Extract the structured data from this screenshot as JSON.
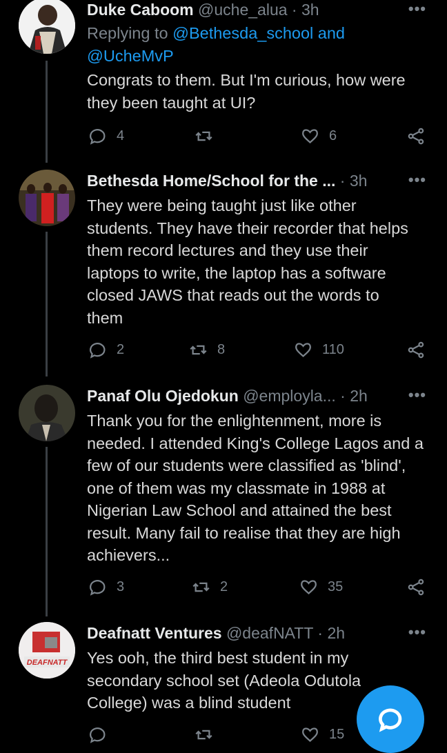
{
  "tweets": [
    {
      "name": "Duke Caboom",
      "handle": "@uche_alua",
      "time": "3h",
      "reply_prefix": "Replying to ",
      "reply_mention1": "@Bethesda_school",
      "reply_and": " and",
      "reply_mention2": "@UcheMvP",
      "text": "Congrats to them. But I'm curious, how were they been taught at UI?",
      "replies": "4",
      "retweets": "",
      "likes": "6"
    },
    {
      "name": "Bethesda Home/School for the ...",
      "handle": "",
      "time": "3h",
      "text": "They were being taught just like other students. They have their recorder that helps them record lectures and they use their laptops to write, the laptop has a software closed JAWS that reads out the words to them",
      "replies": "2",
      "retweets": "8",
      "likes": "110"
    },
    {
      "name": "Panaf Olu Ojedokun",
      "handle": "@employla...",
      "time": "2h",
      "text": "Thank you for the enlightenment, more is needed. I attended King's College Lagos and a few of our students were classified as 'blind', one of them was my classmate in 1988 at Nigerian Law School and attained the best result. Many fail to realise that they are high achievers...",
      "replies": "3",
      "retweets": "2",
      "likes": "35"
    },
    {
      "name": "Deafnatt Ventures",
      "handle": "@deafNATT",
      "time": "2h",
      "avatar_text": "DEAFNATT",
      "text": "Yes ooh, the third best student in my secondary school set (Adeola Odutola College) was a blind student",
      "replies": "",
      "retweets": "",
      "likes": "15"
    }
  ],
  "dot": "·",
  "more": "•••",
  "icons": [
    "reply-icon",
    "retweet-icon",
    "like-icon",
    "share-icon",
    "compose-reply-icon"
  ],
  "colors": {
    "background": "#000000",
    "accent": "#1d9bf0",
    "muted": "#7c848c",
    "text": "#d9d9d9"
  }
}
